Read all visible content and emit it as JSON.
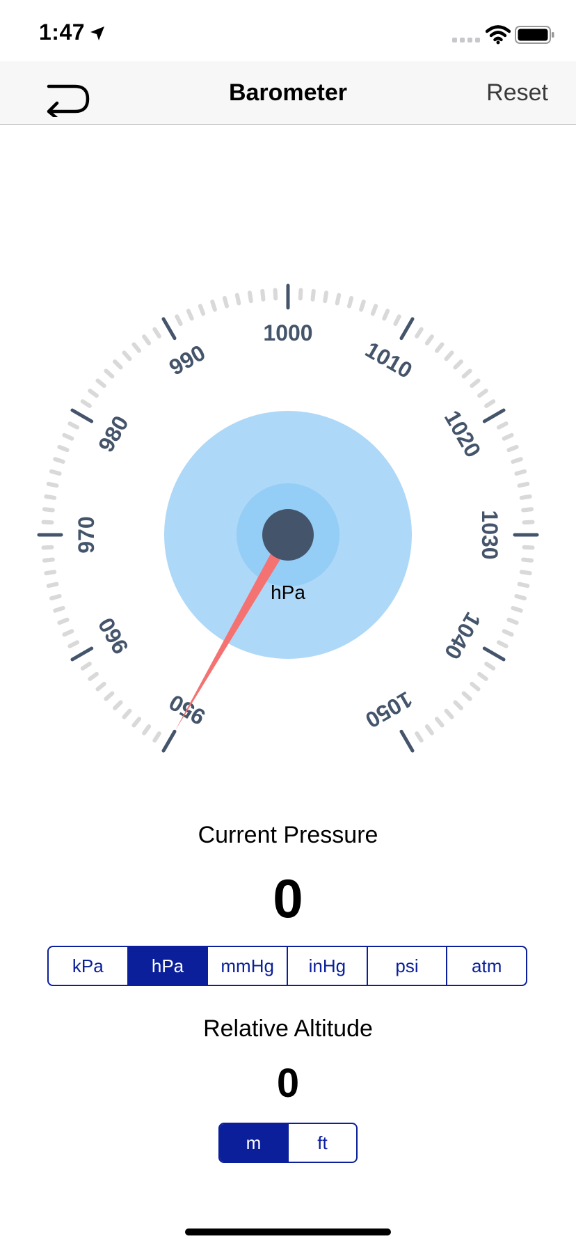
{
  "status": {
    "time": "1:47"
  },
  "nav": {
    "title": "Barometer",
    "reset_label": "Reset",
    "back_icon": "return-arrow-icon"
  },
  "gauge": {
    "min": 950,
    "max": 1050,
    "major_ticks": [
      "950",
      "960",
      "970",
      "980",
      "990",
      "1000",
      "1010",
      "1020",
      "1030",
      "1040",
      "1050"
    ],
    "unit": "hPa",
    "needle_value": 950,
    "colors": {
      "dial_outer": "#aed8f7",
      "dial_inner": "#94cdf5",
      "hub": "#44546a",
      "needle": "#f47272",
      "tick": "#44546a",
      "minor_tick": "#d9d9d9"
    }
  },
  "pressure": {
    "label": "Current Pressure",
    "value": "0",
    "units": [
      "kPa",
      "hPa",
      "mmHg",
      "inHg",
      "psi",
      "atm"
    ],
    "selected_unit": "hPa"
  },
  "altitude": {
    "label": "Relative Altitude",
    "value": "0",
    "units": [
      "m",
      "ft"
    ],
    "selected_unit": "m"
  },
  "accent_color": "#0a1f99"
}
